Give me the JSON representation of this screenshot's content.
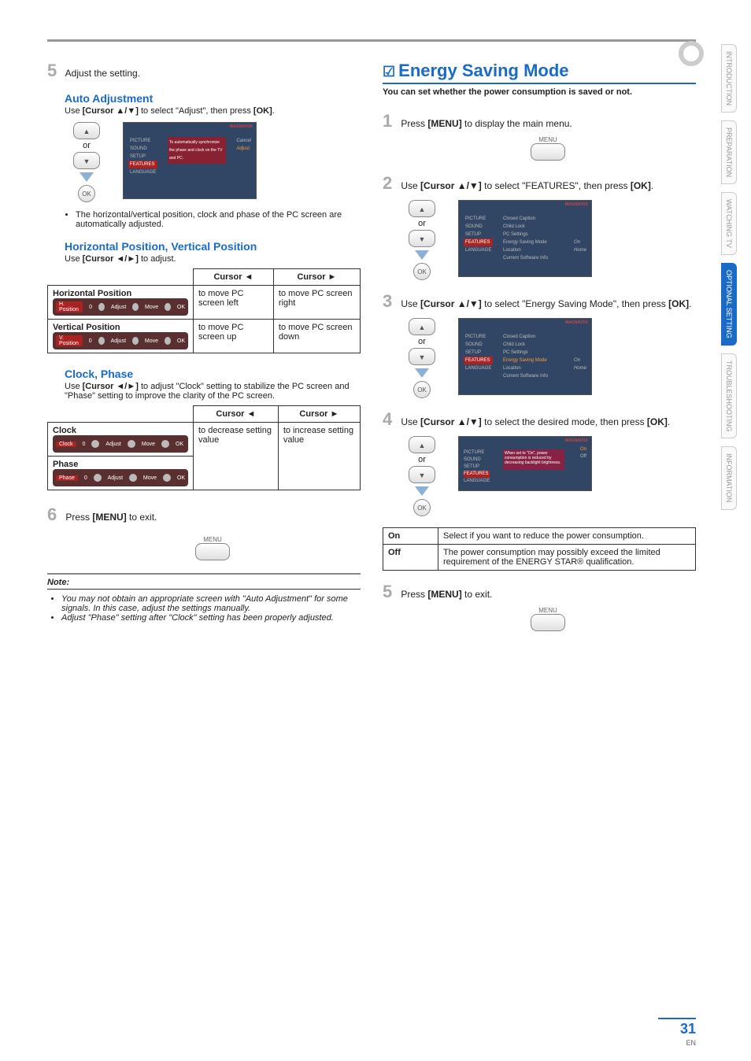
{
  "page_number": "31",
  "page_lang": "EN",
  "left": {
    "step5": {
      "num": "5",
      "text": "Adjust the setting."
    },
    "auto_adj": {
      "title": "Auto Adjustment",
      "instruction_pre": "Use ",
      "instruction_key": "[Cursor ▲/▼]",
      "instruction_mid": " to select \"Adjust\", then press ",
      "instruction_key2": "[OK]",
      "instruction_end": ".",
      "or": "or",
      "ok": "OK",
      "screen": {
        "brand": "MAGNAVOX",
        "menu": [
          "PICTURE",
          "SOUND",
          "SETUP",
          "FEATURES",
          "LANGUAGE"
        ],
        "right": [
          "Cancel",
          "Adjust"
        ],
        "desc": "To automatically synchronize the phase and clock on the TV and PC."
      },
      "bullet": "The horizontal/vertical position, clock and phase of the PC screen are automatically adjusted."
    },
    "hv": {
      "title": "Horizontal Position, Vertical Position",
      "instruction_pre": "Use ",
      "instruction_key": "[Cursor ◄/►]",
      "instruction_end": " to adjust.",
      "th_left": "Cursor ◄",
      "th_right": "Cursor ►",
      "row1_head": "Horizontal Position",
      "row1_strip": {
        "label": "H. Position",
        "val": "0",
        "adj": "Adjust",
        "mov": "Move",
        "ok": "OK"
      },
      "row1_l": "to move PC screen left",
      "row1_r": "to move PC screen right",
      "row2_head": "Vertical Position",
      "row2_strip": {
        "label": "V. Position",
        "val": "0",
        "adj": "Adjust",
        "mov": "Move",
        "ok": "OK"
      },
      "row2_l": "to move PC screen up",
      "row2_r": "to move PC screen down"
    },
    "cp": {
      "title": "Clock, Phase",
      "instruction_pre": "Use ",
      "instruction_key": "[Cursor ◄/►]",
      "instruction_end": " to adjust \"Clock\" setting to stabilize the PC screen and \"Phase\" setting to improve the clarity of the PC screen.",
      "th_left": "Cursor ◄",
      "th_right": "Cursor ►",
      "row1_head": "Clock",
      "row1_strip": {
        "label": "Clock",
        "val": "0",
        "adj": "Adjust",
        "mov": "Move",
        "ok": "OK"
      },
      "row2_head": "Phase",
      "row2_strip": {
        "label": "Phase",
        "val": "0",
        "adj": "Adjust",
        "mov": "Move",
        "ok": "OK"
      },
      "cell_l": "to decrease setting value",
      "cell_r": "to increase setting value"
    },
    "step6": {
      "num": "6",
      "text_pre": "Press ",
      "key": "[MENU]",
      "text_end": " to exit.",
      "btn": "MENU"
    },
    "note": {
      "head": "Note:",
      "items": [
        "You may not obtain an appropriate screen with \"Auto Adjustment\" for some signals. In this case, adjust the settings manually.",
        "Adjust \"Phase\" setting after \"Clock\" setting has been properly adjusted."
      ]
    }
  },
  "right": {
    "title": "Energy Saving Mode",
    "chk": "☑",
    "subtitle": "You can set whether the power consumption is saved or not.",
    "s1": {
      "num": "1",
      "text_pre": "Press ",
      "key": "[MENU]",
      "text_end": " to display the main menu.",
      "btn": "MENU"
    },
    "s2": {
      "num": "2",
      "text_pre": "Use ",
      "key": "[Cursor ▲/▼]",
      "text_mid": " to select \"FEATURES\", then press ",
      "key2": "[OK]",
      "text_end": ".",
      "or": "or",
      "ok": "OK",
      "screen": {
        "brand": "MAGNAVOX",
        "menu": [
          "PICTURE",
          "SOUND",
          "SETUP",
          "FEATURES",
          "LANGUAGE"
        ],
        "mid": [
          "Closed Caption",
          "Child Lock",
          "PC Settings",
          "Energy Saving Mode",
          "Location",
          "Current Software Info"
        ],
        "right": [
          "On",
          "Home"
        ]
      }
    },
    "s3": {
      "num": "3",
      "text_pre": "Use ",
      "key": "[Cursor ▲/▼]",
      "text_mid": " to select \"Energy Saving Mode\", then press ",
      "key2": "[OK]",
      "text_end": ".",
      "or": "or",
      "ok": "OK",
      "screen": {
        "brand": "MAGNAVOX",
        "menu": [
          "PICTURE",
          "SOUND",
          "SETUP",
          "FEATURES",
          "LANGUAGE"
        ],
        "mid": [
          "Closed Caption",
          "Child Lock",
          "PC Settings",
          "Energy Saving Mode",
          "Location",
          "Current Software Info"
        ],
        "right": [
          "On",
          "Home"
        ]
      }
    },
    "s4": {
      "num": "4",
      "text_pre": "Use ",
      "key": "[Cursor ▲/▼]",
      "text_mid": " to select the desired mode, then press ",
      "key2": "[OK]",
      "text_end": ".",
      "or": "or",
      "ok": "OK",
      "screen": {
        "brand": "MAGNAVOX",
        "menu": [
          "PICTURE",
          "SOUND",
          "SETUP",
          "FEATURES",
          "LANGUAGE"
        ],
        "opts": [
          "On",
          "Off"
        ],
        "desc": "When set to \"On\", power consumption is reduced by decreasing backlight brightness."
      }
    },
    "table": {
      "r1k": "On",
      "r1v": "Select if you want to reduce the power consumption.",
      "r2k": "Off",
      "r2v": "The power consumption may possibly exceed the limited requirement of the ENERGY STAR® qualification."
    },
    "s5": {
      "num": "5",
      "text_pre": "Press ",
      "key": "[MENU]",
      "text_end": " to exit.",
      "btn": "MENU"
    }
  },
  "tabs": [
    "INTRODUCTION",
    "PREPARATION",
    "WATCHING TV",
    "OPTIONAL SETTING",
    "TROUBLESHOOTING",
    "INFORMATION"
  ]
}
